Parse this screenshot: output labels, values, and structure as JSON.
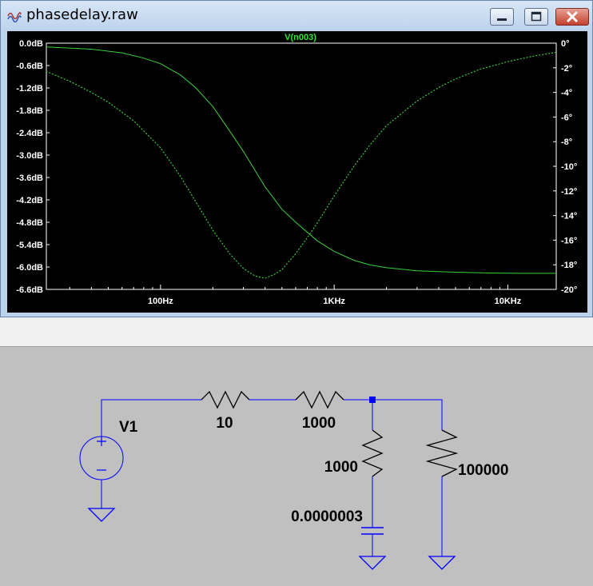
{
  "window": {
    "title": "phasedelay.raw"
  },
  "icons": {
    "title": "waveform-file-icon",
    "minimize": "minimize-icon",
    "maximize": "maximize-icon",
    "close": "close-icon"
  },
  "chart_data": {
    "type": "line",
    "title": "V(n003)",
    "x_scale": "log",
    "xlim": [
      22,
      19000
    ],
    "x_ticks": [
      {
        "value": 100,
        "label": "100Hz"
      },
      {
        "value": 1000,
        "label": "1KHz"
      },
      {
        "value": 10000,
        "label": "10KHz"
      }
    ],
    "y_left": {
      "range": [
        -6.6,
        0
      ],
      "ticks": [
        "0.0dB",
        "-0.6dB",
        "-1.2dB",
        "-1.8dB",
        "-2.4dB",
        "-3.0dB",
        "-3.6dB",
        "-4.2dB",
        "-4.8dB",
        "-5.4dB",
        "-6.0dB",
        "-6.6dB"
      ]
    },
    "y_right": {
      "range": [
        -20,
        0
      ],
      "ticks": [
        "0°",
        "-2°",
        "-4°",
        "-6°",
        "-8°",
        "-10°",
        "-12°",
        "-14°",
        "-16°",
        "-18°",
        "-20°"
      ]
    },
    "grid": false,
    "colors": {
      "trace": "#3ccf3c",
      "background": "#000000",
      "axis": "#ffffff",
      "title": "#2ee82e"
    },
    "series": [
      {
        "axis": "left",
        "style": "solid",
        "x": [
          22,
          40,
          60,
          80,
          100,
          130,
          160,
          200,
          250,
          300,
          400,
          500,
          600,
          800,
          1000,
          1300,
          1600,
          2000,
          3000,
          5000,
          8000,
          12000,
          19000
        ],
        "y": [
          -0.1,
          -0.16,
          -0.26,
          -0.4,
          -0.55,
          -0.85,
          -1.2,
          -1.7,
          -2.35,
          -2.9,
          -3.85,
          -4.45,
          -4.8,
          -5.3,
          -5.58,
          -5.82,
          -5.94,
          -6.02,
          -6.1,
          -6.14,
          -6.16,
          -6.17,
          -6.17
        ]
      },
      {
        "axis": "right",
        "style": "dotted",
        "x": [
          22,
          30,
          40,
          50,
          70,
          100,
          130,
          160,
          200,
          250,
          300,
          350,
          400,
          450,
          500,
          600,
          700,
          800,
          1000,
          1300,
          1600,
          2000,
          3000,
          4000,
          5000,
          7000,
          10000,
          14000,
          19000
        ],
        "y": [
          -2.3,
          -3.1,
          -4.0,
          -4.8,
          -6.3,
          -8.5,
          -10.8,
          -12.9,
          -15.2,
          -17.1,
          -18.3,
          -18.9,
          -19.1,
          -18.8,
          -18.4,
          -17.1,
          -15.8,
          -14.6,
          -12.4,
          -10.0,
          -8.3,
          -6.7,
          -4.7,
          -3.6,
          -2.9,
          -2.1,
          -1.5,
          -1.05,
          -0.75
        ]
      }
    ]
  },
  "schematic": {
    "source_label": "V1",
    "r_series1": "10",
    "r_series2": "1000",
    "r_shunt": "1000",
    "c_shunt": "0.0000003",
    "r_load": "100000",
    "wire_color": "#0000ff",
    "text_color": "#000000"
  }
}
